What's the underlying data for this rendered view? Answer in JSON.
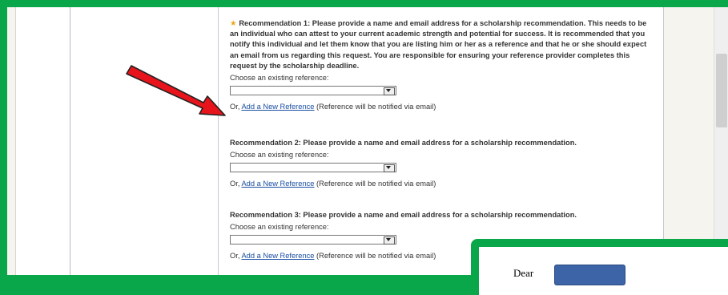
{
  "recommendations": [
    {
      "heading": "Recommendation 1: Please provide a name and email address for a scholarship recommendation. This needs to be an individual who can attest to your current academic strength and potential for success. It is recommended that you notify this individual and let them know that you are listing him or her as a reference and that he or she should expect an email from us regarding this request. You are responsible for ensuring your reference provider completes this request by the scholarship deadline.",
      "required_marker": "★",
      "choose_label": "Choose an existing reference:",
      "select_value": "",
      "or_prefix": "Or,",
      "add_link": "Add a New Reference",
      "note": "(Reference will be notified via email)"
    },
    {
      "heading": "Recommendation 2: Please provide a name and email address for a scholarship recommendation.",
      "choose_label": "Choose an existing reference:",
      "select_value": "",
      "or_prefix": "Or,",
      "add_link": "Add a New Reference",
      "note": "(Reference will be notified via email)"
    },
    {
      "heading": "Recommendation 3: Please provide a name and email address for a scholarship recommendation.",
      "choose_label": "Choose an existing reference:",
      "select_value": "",
      "or_prefix": "Or,",
      "add_link": "Add a New Reference",
      "note": "(Reference will be notified via email)"
    }
  ],
  "letter": {
    "salutation": "Dear"
  },
  "colors": {
    "highlight_border": "#0aa64a",
    "arrow": "#e8141b",
    "link": "#1a4fa3",
    "redaction": "#3d64a6"
  }
}
